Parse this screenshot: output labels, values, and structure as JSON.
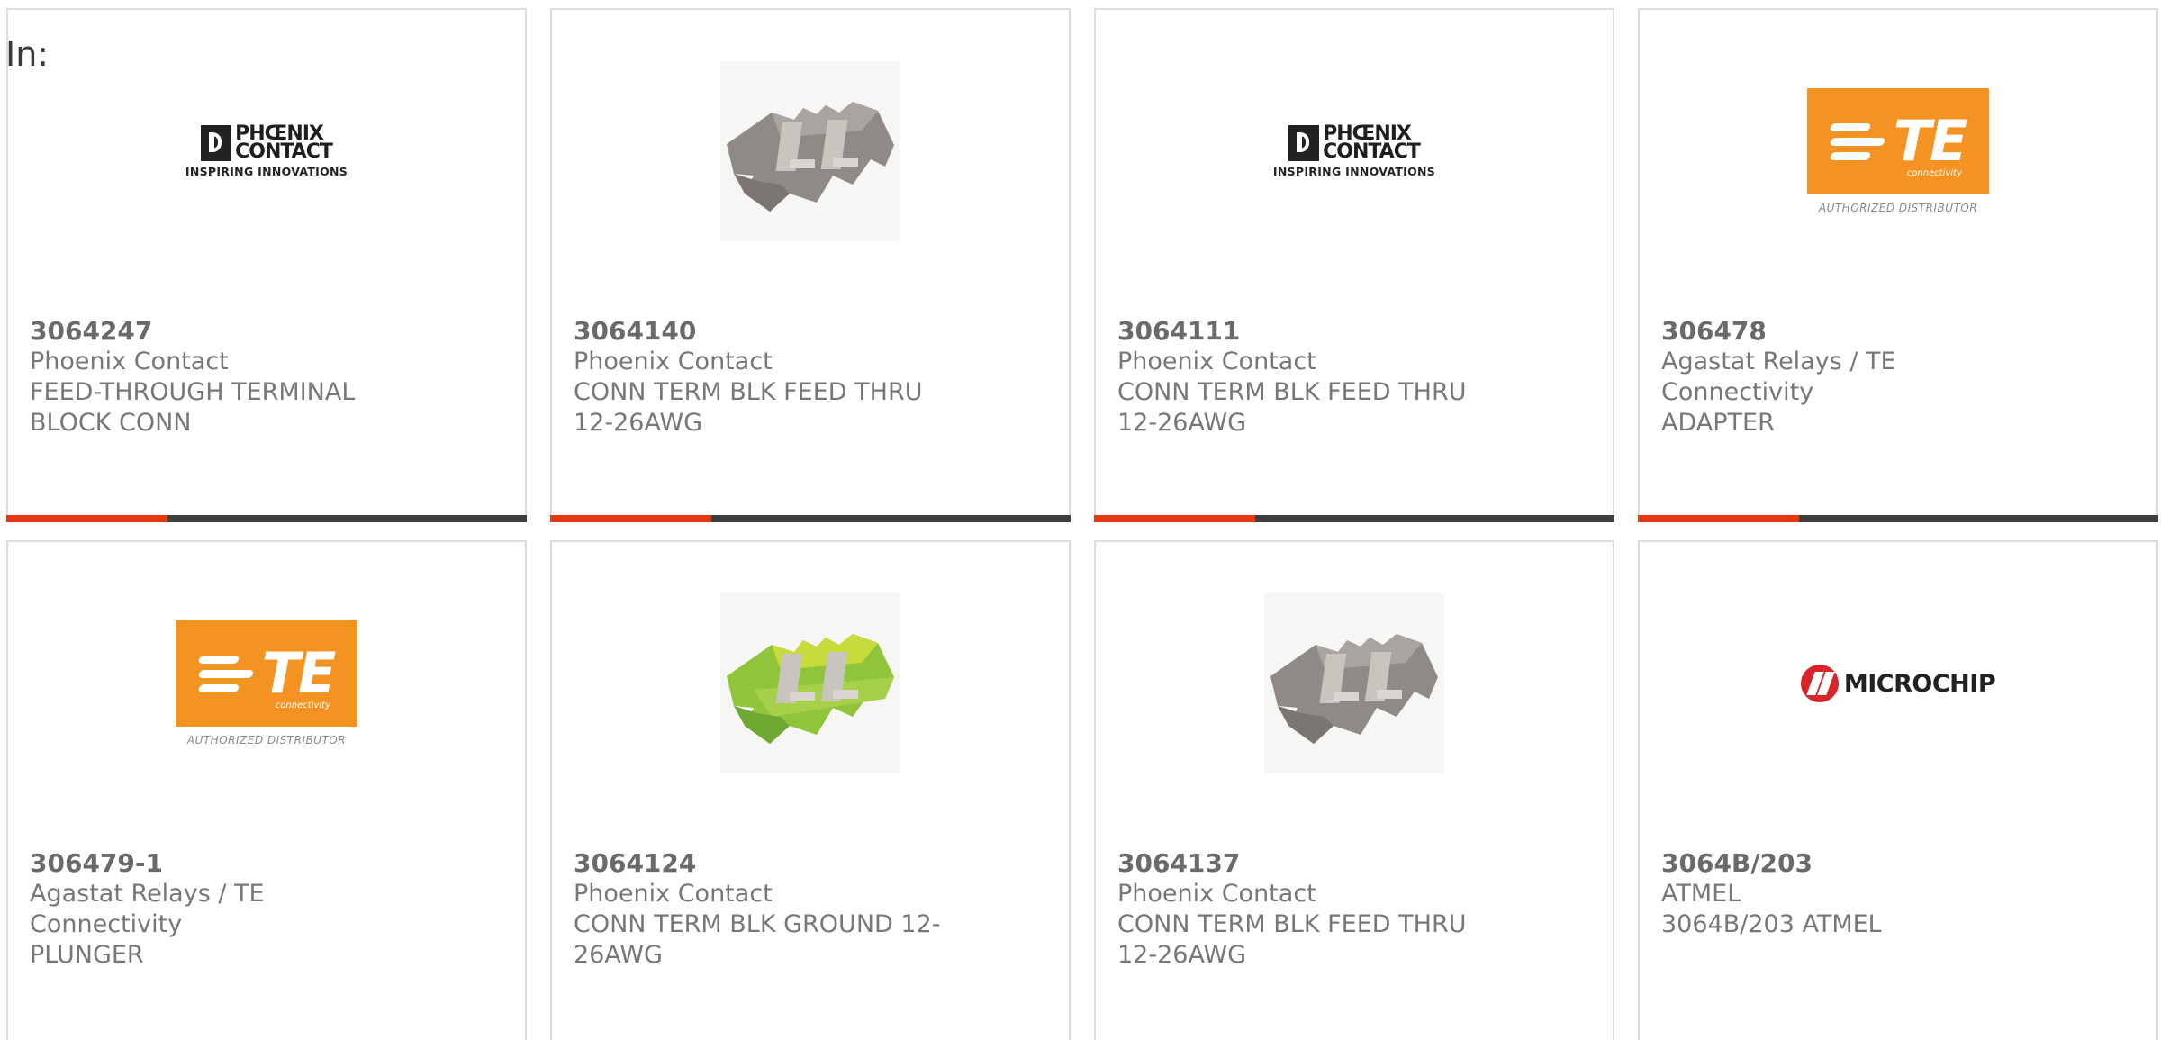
{
  "filter": {
    "label": "In:"
  },
  "colors": {
    "accent_bar": "#e33a12",
    "bar_base": "#3d3d3d",
    "card_border": "#dcdcdc",
    "te_orange": "#f59322",
    "microchip_red": "#d7262b",
    "terminal_gray": "#8f8a85",
    "terminal_green": "#8fc43b"
  },
  "products": [
    {
      "part_number": "3064247",
      "manufacturer": "Phoenix Contact",
      "description": "FEED-THROUGH TERMINAL BLOCK CONN",
      "image": "phoenix-contact-logo",
      "logo": {
        "line1": "PHŒNIX",
        "line2": "CONTACT",
        "tagline": "INSPIRING INNOVATIONS"
      },
      "progress": 0.31
    },
    {
      "part_number": "3064140",
      "manufacturer": "Phoenix Contact",
      "description": "CONN TERM BLK FEED THRU 12-26AWG",
      "image": "terminal-block-gray",
      "progress": 0.31
    },
    {
      "part_number": "3064111",
      "manufacturer": "Phoenix Contact",
      "description": "CONN TERM BLK FEED THRU 12-26AWG",
      "image": "phoenix-contact-logo",
      "logo": {
        "line1": "PHŒNIX",
        "line2": "CONTACT",
        "tagline": "INSPIRING INNOVATIONS"
      },
      "progress": 0.31
    },
    {
      "part_number": "306478",
      "manufacturer": "Agastat Relays / TE Connectivity",
      "description": "ADAPTER",
      "image": "te-connectivity-logo",
      "logo": {
        "mark": "TE",
        "sub": "connectivity",
        "tagline": "AUTHORIZED DISTRIBUTOR"
      },
      "progress": 0.31
    },
    {
      "part_number": "306479-1",
      "manufacturer": "Agastat Relays / TE Connectivity",
      "description": "PLUNGER",
      "image": "te-connectivity-logo",
      "logo": {
        "mark": "TE",
        "sub": "connectivity",
        "tagline": "AUTHORIZED DISTRIBUTOR"
      }
    },
    {
      "part_number": "3064124",
      "manufacturer": "Phoenix Contact",
      "description": "CONN TERM BLK GROUND 12-26AWG",
      "image": "terminal-block-green"
    },
    {
      "part_number": "3064137",
      "manufacturer": "Phoenix Contact",
      "description": "CONN TERM BLK FEED THRU 12-26AWG",
      "image": "terminal-block-gray"
    },
    {
      "part_number": "3064B/203",
      "manufacturer": "ATMEL",
      "description": "3064B/203 ATMEL",
      "image": "microchip-logo",
      "logo": {
        "text": "MICROCHIP"
      }
    }
  ]
}
